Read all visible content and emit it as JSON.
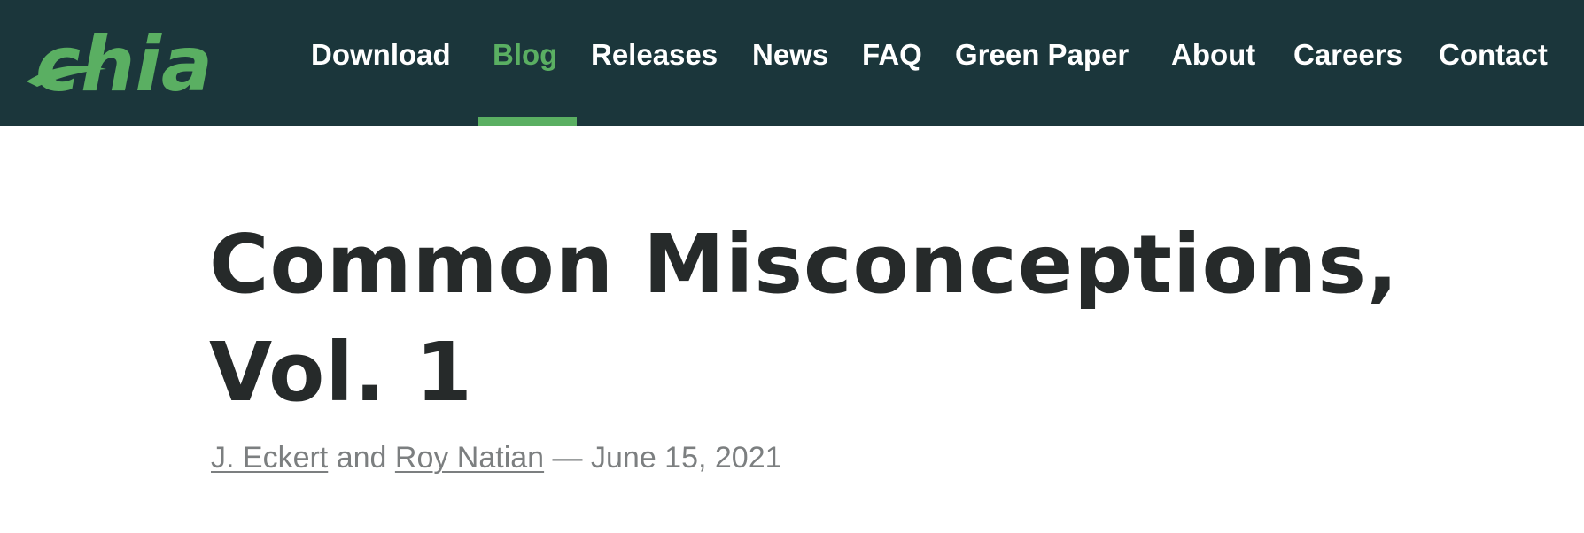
{
  "header": {
    "logo_text": "chia",
    "nav": [
      {
        "label": "Download",
        "active": false
      },
      {
        "label": "Blog",
        "active": true
      },
      {
        "label": "Releases",
        "active": false
      },
      {
        "label": "News",
        "active": false
      },
      {
        "label": "FAQ",
        "active": false
      },
      {
        "label": "Green Paper",
        "active": false
      },
      {
        "label": "About",
        "active": false
      },
      {
        "label": "Careers",
        "active": false
      },
      {
        "label": "Contact",
        "active": false
      }
    ]
  },
  "article": {
    "title_line1": "Common Misconceptions,",
    "title_line2": "Vol. 1",
    "author1": "J. Eckert",
    "conjunction": "and",
    "author2": "Roy Natian",
    "separator": "—",
    "date": "June 15, 2021"
  },
  "colors": {
    "header_bg": "#1b363b",
    "accent_green": "#5aaf62",
    "title_text": "#262a2a",
    "byline_text": "#7c7f80"
  },
  "icons": {
    "logo": "chia-leaf-logo"
  }
}
